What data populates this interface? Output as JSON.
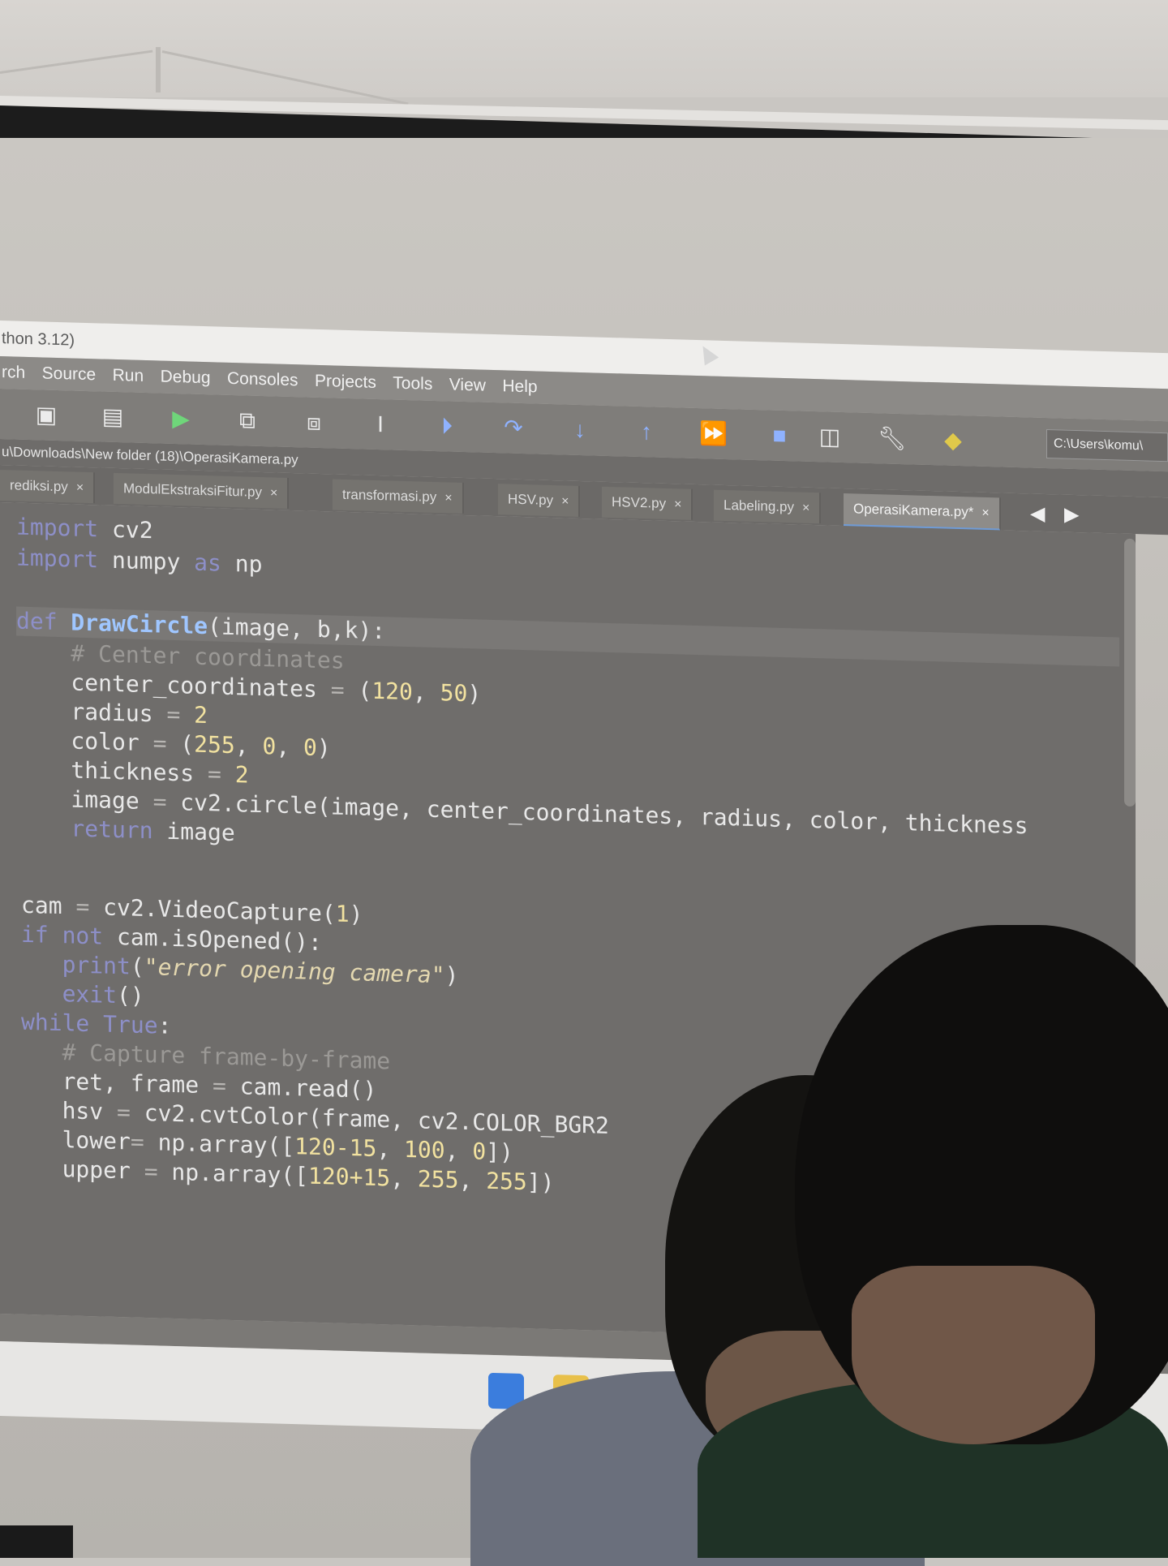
{
  "window": {
    "title": "thon 3.12)"
  },
  "menu": [
    "rch",
    "Source",
    "Run",
    "Debug",
    "Consoles",
    "Projects",
    "Tools",
    "View",
    "Help"
  ],
  "toolbar": {
    "icons": [
      "save-icon",
      "save-all-icon",
      "run-icon",
      "run-cell-icon",
      "run-cell-advance-icon",
      "run-selection-icon",
      "debug-icon",
      "step-over-icon",
      "step-into-icon",
      "step-return-icon",
      "continue-icon",
      "stop-icon",
      "maximize-pane-icon",
      "preferences-icon",
      "python-path-icon"
    ],
    "working_dir": "C:\\Users\\komu\\"
  },
  "file_path": "u\\Downloads\\New folder (18)\\OperasiKamera.py",
  "tabs": [
    {
      "label": "rediksi.py",
      "active": false
    },
    {
      "label": "ModulEkstraksiFitur.py",
      "active": false
    },
    {
      "label": "transformasi.py",
      "active": false
    },
    {
      "label": "HSV.py",
      "active": false
    },
    {
      "label": "HSV2.py",
      "active": false
    },
    {
      "label": "Labeling.py",
      "active": false
    },
    {
      "label": "OperasiKamera.py*",
      "active": true
    }
  ],
  "tab_close": "×",
  "tab_nav": {
    "prev": "◀",
    "next": "▶"
  },
  "code": {
    "l1_kw": "import",
    "l1_rest": " cv2",
    "l2_kw": "import",
    "l2_mod": " numpy ",
    "l2_as": "as",
    "l2_rest": " np",
    "l3_kw": "def",
    "l3_fn": " DrawCircle",
    "l3_rest": "(image, b,k):",
    "l4_cm": "    # Center coordinates",
    "l5_a": "    center_coordinates ",
    "l5_op": "=",
    "l5_b": " (",
    "l5_n1": "120",
    "l5_c": ", ",
    "l5_n2": "50",
    "l5_d": ")",
    "l6_a": "    radius ",
    "l6_op": "=",
    "l6_n": " 2",
    "l7_a": "    color ",
    "l7_op": "=",
    "l7_b": " (",
    "l7_n1": "255",
    "l7_c1": ", ",
    "l7_n2": "0",
    "l7_c2": ", ",
    "l7_n3": "0",
    "l7_d": ")",
    "l8_a": "    thickness ",
    "l8_op": "=",
    "l8_n": " 2",
    "l9_a": "    image ",
    "l9_op": "=",
    "l9_b": " cv2.circle(image, center_coordinates, radius, color, thickness",
    "l10_kw": "    return",
    "l10_rest": " image",
    "l11_a": "cam ",
    "l11_op": "=",
    "l11_b": " cv2.VideoCapture(",
    "l11_n": "1",
    "l11_c": ")",
    "l12_kw1": "if",
    "l12_kw2": " not",
    "l12_rest": " cam.isOpened():",
    "l13_kw": "   print",
    "l13_a": "(",
    "l13_str": "\"error opening camera\"",
    "l13_b": ")",
    "l14_kw": "   exit",
    "l14_rest": "()",
    "l15_kw1": "while",
    "l15_kw2": " True",
    "l15_rest": ":",
    "l16_cm": "   # Capture frame-by-frame",
    "l17_a": "   ret, frame ",
    "l17_op": "=",
    "l17_b": " cam.read()",
    "l18_a": "   hsv ",
    "l18_op": "=",
    "l18_b": " cv2.cvtColor(frame, cv2.COLOR_BGR2",
    "l19_a": "   lower",
    "l19_op": "=",
    "l19_b": " np.array([",
    "l19_n1": "120-15",
    "l19_c1": ", ",
    "l19_n2": "100",
    "l19_c2": ", ",
    "l19_n3": "0",
    "l19_d": "])",
    "l20_a": "   upper ",
    "l20_op": "=",
    "l20_b": " np.array([",
    "l20_n1": "120+15",
    "l20_c1": ", ",
    "l20_n2": "255",
    "l20_c2": ", ",
    "l20_n3": "255",
    "l20_d": "])"
  },
  "colors": {
    "editor_bg": "#6f6d6b",
    "keyword": "#8d8fc8",
    "function": "#9fc6ff",
    "number": "#f2e2a0",
    "comment": "#9b9996",
    "active_tab_underline": "#6f9bd6"
  }
}
